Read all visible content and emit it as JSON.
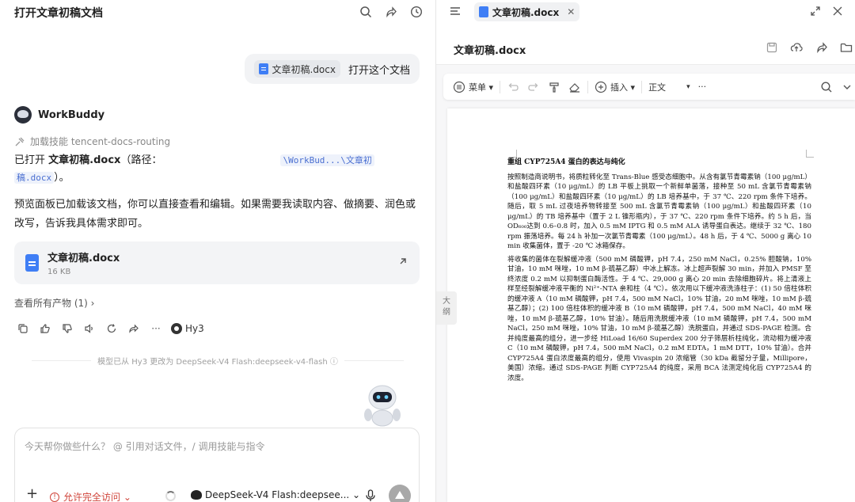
{
  "chat": {
    "title": "打开文章初稿文档",
    "user_file_chip": "文章初稿.docx",
    "user_message": "打开这个文档",
    "bot_name": "WorkBuddy",
    "skill_line": "加载技能 tencent-docs-routing",
    "reply_prefix": "已打开",
    "reply_filename": "文章初稿.docx",
    "reply_path_label": "（路径：",
    "reply_path_1": "\\WorkBud...\\文章初",
    "reply_path_2": "稿.docx",
    "reply_suffix": "）。",
    "reply_2": "预览面板已加载该文档，你可以直接查看和编辑。如果需要我读取内容、做摘要、润色或改写，告诉我具体需求即可。",
    "file_card_name": "文章初稿.docx",
    "file_card_size": "16 KB",
    "view_all": "查看所有产物 (1) ›",
    "hy3_label": "Hy3",
    "model_note": "模型已从 Hy3 更改为 DeepSeek-V4 Flash:deepseek-v4-flash ⓘ",
    "input_placeholder": "今天帮你做些什么？ @ 引用对话文件，/ 调用技能与指令",
    "access_label": "允许完全访问 ⌄",
    "model_select_label": "DeepSeek-V4 Flash:deepsee... ⌄"
  },
  "doc_panel": {
    "tab_label": "文章初稿.docx",
    "tab_close": "✕",
    "doc_title": "文章初稿.docx",
    "toolbar": {
      "menu": "菜单 ▾",
      "insert": "插入 ▾",
      "style": "正文",
      "style_caret": "▾",
      "more": "···"
    },
    "outline_tab": "大纲",
    "heading": "重组 CYP725A4 蛋白的表达与纯化",
    "para_1": "按照制造商说明书，将质粒转化至 Trans-Blue 感受态细胞中。从含有氯节青霉素钠（100 μg/mL）和盐酸四环素（10 μg/mL）的 LB 平板上挑取一个新鲜单菌落，接种至 50 mL 含氯节青霉素钠（100 μg/mL）和盐酸四环素（10 μg/mL）的 LB 培养基中，于 37 ℃、220 rpm 条件下培养。随后，取 5 mL 过夜培养物转接至 500 mL 含氯节青霉素钠（100 μg/mL）和盐酸四环素（10 μg/mL）的 TB 培养基中（置于 2 L 锥形瓶内），于 37 ℃、220 rpm 条件下培养。约 5 h 后，当 OD₆₀₀达到 0.6–0.8 时，加入 0.5 mM IPTG 和 0.5 mM ALA 诱导蛋白表达。继续于 32 ℃、180 rpm 振荡培养。每 24 h 补加一次氯节青霉素（100 μg/mL）。48 h 后，于 4 ℃、5000 g 离心 10 min 收集菌体，置于 -20 ℃ 冰箱保存。",
    "para_2": "将收集的菌体在裂解缓冲液（500 mM 磷酸钾，pH 7.4，250 mM NaCl，0.25% 胆酸钠，10% 甘油，10 mM 咪唑，10 mM β-巯基乙醇）中冰上解冻。冰上超声裂解 30 min，并加入 PMSF 至终浓度 0.2 mM 以抑制蛋白酶活性。于 4 ℃、29,000 g 离心 20 min 去除细胞碎片。将上清液上样至经裂解缓冲液平衡的 Ni²⁺-NTA 亲和柱（4 ℃）。依次用以下缓冲液洗涤柱子：(1) 50 倍柱体积的缓冲液 A（10 mM 磷酸钾，pH 7.4，500 mM NaCl，10% 甘油，20 mM 咪唑，10 mM β-巯基乙醇）；(2) 100 倍柱体积的缓冲液 B（10 mM 磷酸钾，pH 7.4，500 mM NaCl，40 mM 咪唑，10 mM β-巯基乙醇，10% 甘油）。随后用洗脱缓冲液（10 mM 磷酸钾，pH 7.4，500 mM NaCl，250 mM 咪唑，10% 甘油，10 mM β-巯基乙醇）洗脱蛋白，并通过 SDS-PAGE 检测。合并纯度最高的组分，进一步经 HiLoad 16/60 Superdex 200 分子筛层析柱纯化，流动相为缓冲液 C（10 mM 磷酸钾，pH 7.4，500 mM NaCl，0.2 mM EDTA，1 mM DTT，10% 甘油）。合并 CYP725A4 蛋白浓度最高的组分，使用 Vivaspin 20 浓缩管（30 kDa 截留分子量，Millipore，美国）浓缩。通过 SDS-PAGE 判断 CYP725A4 的纯度，采用 BCA 法测定纯化后 CYP725A4 的浓度。"
  },
  "colors": {
    "accent_blue": "#3f7ef5",
    "warning_red": "#d0453b",
    "panel_bg": "#f7f7f8"
  }
}
